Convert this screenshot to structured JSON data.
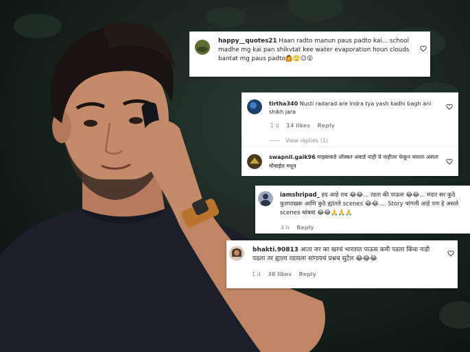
{
  "comments": [
    {
      "username": "happy__quotes21",
      "text": "Haan radto manun paus padto kai... school madhe mg kai pan shikvtat kee water evaporation houn clouds bantat mg paus padto🙆🙄😑😮"
    },
    {
      "username": "tirtha340",
      "text": "Nusti radarad are indra tya yash kadhi bagh ani shikh jara",
      "age": "1 d",
      "likes": "14 likes",
      "reply": "Reply",
      "view_replies": "View replies (1)"
    },
    {
      "username": "swapnil.gaik96",
      "text": "माझ्याकडे ऑस्कर अवार्ड नाही ये नाहीतर फेकून मारला असता मोबाईल मधून"
    },
    {
      "username": "iamshripad_",
      "text": "हद आहे राव 😂😂... रडता की पाऊस 😂😂... मंदार सर कुठे फुलपाखरू आणि कुठे ह्यांतले scenes 😂😂.... Story चांगली आहे पण हे असले scenes थांबवा 😂😂🙏🙏🙏",
      "age": "4 h",
      "reply": "Reply"
    },
    {
      "username": "bhakti.90813",
      "text": "आता जर का खरचं भारतात पाऊस कमी पडला किंवा नाही पडला तर ह्याला रडायला सांगायचं प्रश्नच सुटेल 😂😂😂",
      "age": "1 d",
      "likes": "38 likes",
      "reply": "Reply"
    }
  ],
  "colors": {
    "card_bg": "#ffffff",
    "username": "#262626",
    "meta": "#8e8e8e",
    "shirt": "#1b1f2a",
    "watch_strap": "#b8742a"
  },
  "icons": [
    "heart-icon",
    "avatar",
    "phone"
  ]
}
